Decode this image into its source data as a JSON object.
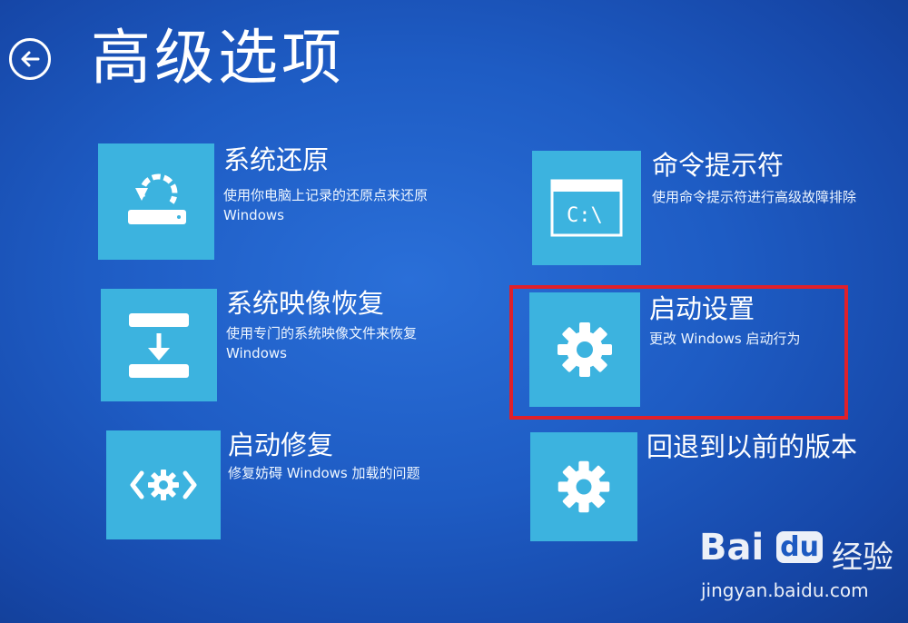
{
  "header": {
    "back_icon": "arrow-left-circle-icon",
    "title": "高级选项"
  },
  "options": [
    {
      "id": "system-restore",
      "icon": "restore-disk-icon",
      "title": "系统还原",
      "desc_line1": "使用你电脑上记录的还原点来还原",
      "desc_line2": "Windows"
    },
    {
      "id": "command-prompt",
      "icon": "command-window-icon",
      "icon_text": "C:\\",
      "title": "命令提示符",
      "desc_line1": "使用命令提示符进行高级故障排除",
      "desc_line2": ""
    },
    {
      "id": "system-image-recovery",
      "icon": "image-recovery-icon",
      "title": "系统映像恢复",
      "desc_line1": "使用专门的系统映像文件来恢复",
      "desc_line2": "Windows"
    },
    {
      "id": "startup-settings",
      "icon": "gear-icon",
      "title": "启动设置",
      "desc_line1": "更改 Windows 启动行为",
      "desc_line2": ""
    },
    {
      "id": "startup-repair",
      "icon": "startup-repair-icon",
      "title": "启动修复",
      "desc_line1": "修复妨碍 Windows 加载的问题",
      "desc_line2": ""
    },
    {
      "id": "go-back",
      "icon": "gear-icon",
      "title": "回退到以前的版本",
      "desc_line1": "",
      "desc_line2": ""
    }
  ],
  "watermark": {
    "brand_latin": "Bai",
    "brand_du": "du",
    "brand_cn": "经验",
    "url": "jingyan.baidu.com"
  },
  "colors": {
    "background": "#1e5cc4",
    "tile": "#3cb3df",
    "highlight": "#e0202a"
  }
}
